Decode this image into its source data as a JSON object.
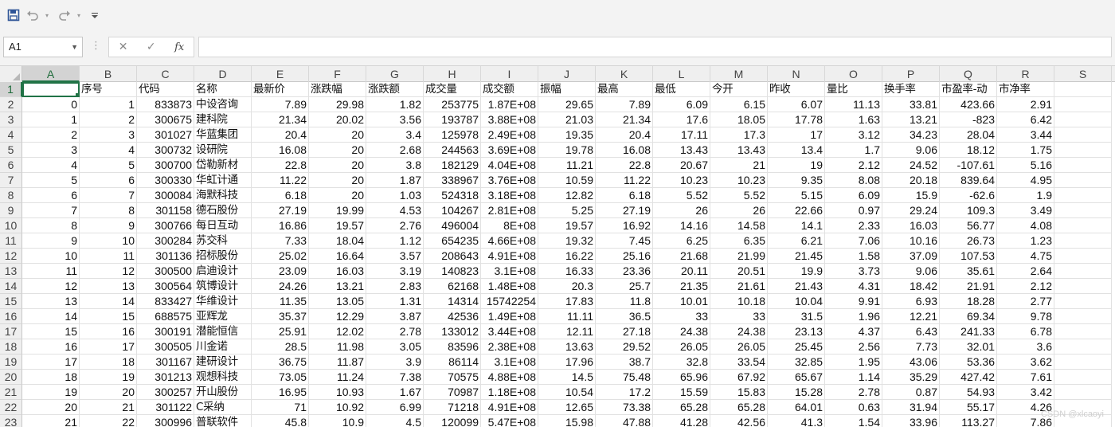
{
  "quick_access": {
    "save_icon": "save-icon",
    "undo_icon": "undo-icon",
    "redo_icon": "redo-icon",
    "customize_icon": "customize-toolbar-icon"
  },
  "formula_bar": {
    "name_box": "A1",
    "cancel_symbol": "✕",
    "confirm_symbol": "✓",
    "fx_label": "fx",
    "formula_value": ""
  },
  "columns": [
    "A",
    "B",
    "C",
    "D",
    "E",
    "F",
    "G",
    "H",
    "I",
    "J",
    "K",
    "L",
    "M",
    "N",
    "O",
    "P",
    "Q",
    "R",
    "S"
  ],
  "row_numbers": [
    "1",
    "2",
    "3",
    "4",
    "5",
    "6",
    "7",
    "8",
    "9",
    "10",
    "11",
    "12",
    "13",
    "14",
    "15",
    "16",
    "17",
    "18",
    "19",
    "20",
    "21",
    "22",
    "23"
  ],
  "cells": [
    [
      "",
      "序号",
      "代码",
      "名称",
      "最新价",
      "涨跌幅",
      "涨跌额",
      "成交量",
      "成交额",
      "振幅",
      "最高",
      "最低",
      "今开",
      "昨收",
      "量比",
      "换手率",
      "市盈率-动",
      "市净率",
      ""
    ],
    [
      "0",
      "1",
      "833873",
      "中设咨询",
      "7.89",
      "29.98",
      "1.82",
      "253775",
      "1.87E+08",
      "29.65",
      "7.89",
      "6.09",
      "6.15",
      "6.07",
      "11.13",
      "33.81",
      "423.66",
      "2.91",
      ""
    ],
    [
      "1",
      "2",
      "300675",
      "建科院",
      "21.34",
      "20.02",
      "3.56",
      "193787",
      "3.88E+08",
      "21.03",
      "21.34",
      "17.6",
      "18.05",
      "17.78",
      "1.63",
      "13.21",
      "-823",
      "6.42",
      ""
    ],
    [
      "2",
      "3",
      "301027",
      "华蓝集团",
      "20.4",
      "20",
      "3.4",
      "125978",
      "2.49E+08",
      "19.35",
      "20.4",
      "17.11",
      "17.3",
      "17",
      "3.12",
      "34.23",
      "28.04",
      "3.44",
      ""
    ],
    [
      "3",
      "4",
      "300732",
      "设研院",
      "16.08",
      "20",
      "2.68",
      "244563",
      "3.69E+08",
      "19.78",
      "16.08",
      "13.43",
      "13.43",
      "13.4",
      "1.7",
      "9.06",
      "18.12",
      "1.75",
      ""
    ],
    [
      "4",
      "5",
      "300700",
      "岱勒新材",
      "22.8",
      "20",
      "3.8",
      "182129",
      "4.04E+08",
      "11.21",
      "22.8",
      "20.67",
      "21",
      "19",
      "2.12",
      "24.52",
      "-107.61",
      "5.16",
      ""
    ],
    [
      "5",
      "6",
      "300330",
      "华虹计通",
      "11.22",
      "20",
      "1.87",
      "338967",
      "3.76E+08",
      "10.59",
      "11.22",
      "10.23",
      "10.23",
      "9.35",
      "8.08",
      "20.18",
      "839.64",
      "4.95",
      ""
    ],
    [
      "6",
      "7",
      "300084",
      "海默科技",
      "6.18",
      "20",
      "1.03",
      "524318",
      "3.18E+08",
      "12.82",
      "6.18",
      "5.52",
      "5.52",
      "5.15",
      "6.09",
      "15.9",
      "-62.6",
      "1.9",
      ""
    ],
    [
      "7",
      "8",
      "301158",
      "德石股份",
      "27.19",
      "19.99",
      "4.53",
      "104267",
      "2.81E+08",
      "5.25",
      "27.19",
      "26",
      "26",
      "22.66",
      "0.97",
      "29.24",
      "109.3",
      "3.49",
      ""
    ],
    [
      "8",
      "9",
      "300766",
      "每日互动",
      "16.86",
      "19.57",
      "2.76",
      "496004",
      "8E+08",
      "19.57",
      "16.92",
      "14.16",
      "14.58",
      "14.1",
      "2.33",
      "16.03",
      "56.77",
      "4.08",
      ""
    ],
    [
      "9",
      "10",
      "300284",
      "苏交科",
      "7.33",
      "18.04",
      "1.12",
      "654235",
      "4.66E+08",
      "19.32",
      "7.45",
      "6.25",
      "6.35",
      "6.21",
      "7.06",
      "10.16",
      "26.73",
      "1.23",
      ""
    ],
    [
      "10",
      "11",
      "301136",
      "招标股份",
      "25.02",
      "16.64",
      "3.57",
      "208643",
      "4.91E+08",
      "16.22",
      "25.16",
      "21.68",
      "21.99",
      "21.45",
      "1.58",
      "37.09",
      "107.53",
      "4.75",
      ""
    ],
    [
      "11",
      "12",
      "300500",
      "启迪设计",
      "23.09",
      "16.03",
      "3.19",
      "140823",
      "3.1E+08",
      "16.33",
      "23.36",
      "20.11",
      "20.51",
      "19.9",
      "3.73",
      "9.06",
      "35.61",
      "2.64",
      ""
    ],
    [
      "12",
      "13",
      "300564",
      "筑博设计",
      "24.26",
      "13.21",
      "2.83",
      "62168",
      "1.48E+08",
      "20.3",
      "25.7",
      "21.35",
      "21.61",
      "21.43",
      "4.31",
      "18.42",
      "21.91",
      "2.12",
      ""
    ],
    [
      "13",
      "14",
      "833427",
      "华维设计",
      "11.35",
      "13.05",
      "1.31",
      "14314",
      "15742254",
      "17.83",
      "11.8",
      "10.01",
      "10.18",
      "10.04",
      "9.91",
      "6.93",
      "18.28",
      "2.77",
      ""
    ],
    [
      "14",
      "15",
      "688575",
      "亚辉龙",
      "35.37",
      "12.29",
      "3.87",
      "42536",
      "1.49E+08",
      "11.11",
      "36.5",
      "33",
      "33",
      "31.5",
      "1.96",
      "12.21",
      "69.34",
      "9.78",
      ""
    ],
    [
      "15",
      "16",
      "300191",
      "潜能恒信",
      "25.91",
      "12.02",
      "2.78",
      "133012",
      "3.44E+08",
      "12.11",
      "27.18",
      "24.38",
      "24.38",
      "23.13",
      "4.37",
      "6.43",
      "241.33",
      "6.78",
      ""
    ],
    [
      "16",
      "17",
      "300505",
      "川金诺",
      "28.5",
      "11.98",
      "3.05",
      "83596",
      "2.38E+08",
      "13.63",
      "29.52",
      "26.05",
      "26.05",
      "25.45",
      "2.56",
      "7.73",
      "32.01",
      "3.6",
      ""
    ],
    [
      "17",
      "18",
      "301167",
      "建研设计",
      "36.75",
      "11.87",
      "3.9",
      "86114",
      "3.1E+08",
      "17.96",
      "38.7",
      "32.8",
      "33.54",
      "32.85",
      "1.95",
      "43.06",
      "53.36",
      "3.62",
      ""
    ],
    [
      "18",
      "19",
      "301213",
      "观想科技",
      "73.05",
      "11.24",
      "7.38",
      "70575",
      "4.88E+08",
      "14.5",
      "75.48",
      "65.96",
      "67.92",
      "65.67",
      "1.14",
      "35.29",
      "427.42",
      "7.61",
      ""
    ],
    [
      "19",
      "20",
      "300257",
      "开山股份",
      "16.95",
      "10.93",
      "1.67",
      "70987",
      "1.18E+08",
      "10.54",
      "17.2",
      "15.59",
      "15.83",
      "15.28",
      "2.78",
      "0.87",
      "54.93",
      "3.42",
      ""
    ],
    [
      "20",
      "21",
      "301122",
      "C采纳",
      "71",
      "10.92",
      "6.99",
      "71218",
      "4.91E+08",
      "12.65",
      "73.38",
      "65.28",
      "65.28",
      "64.01",
      "0.63",
      "31.94",
      "55.17",
      "4.26",
      ""
    ],
    [
      "21",
      "22",
      "300996",
      "普联软件",
      "45.8",
      "10.9",
      "4.5",
      "120099",
      "5.47E+08",
      "15.98",
      "47.88",
      "41.28",
      "42.56",
      "41.3",
      "1.54",
      "33.96",
      "113.27",
      "7.86",
      ""
    ]
  ],
  "watermark": "CSDN @xlcaoyi"
}
